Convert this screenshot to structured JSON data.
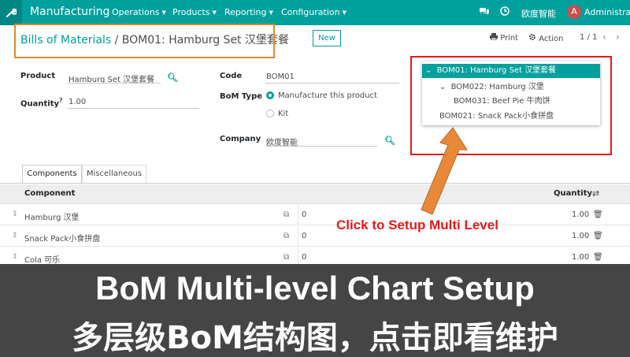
{
  "topbar": {
    "app_name": "Manufacturing",
    "menus": [
      "Operations",
      "Products",
      "Reporting",
      "Configuration"
    ],
    "company": "欧度智能",
    "avatar_letter": "A",
    "user": "Administrator",
    "accent_color": "#00a09d"
  },
  "control_panel": {
    "breadcrumb_parent": "Bills of Materials",
    "breadcrumb_sep": "/",
    "breadcrumb_current": "BOM01: Hamburg Set 汉堡套餐",
    "new_label": "New",
    "print_label": "Print",
    "action_label": "Action",
    "pager": "1 / 1"
  },
  "form": {
    "product_label": "Product",
    "product_value": "Hamburg Set 汉堡套餐",
    "quantity_label": "Quantity",
    "quantity_required": "?",
    "quantity_value": "1.00",
    "code_label": "Code",
    "code_value": "BOM01",
    "bom_type_label": "BoM Type",
    "bom_type_options": [
      "Manufacture this product",
      "Kit"
    ],
    "bom_type_selected": "Manufacture this product",
    "company_label": "Company",
    "company_value": "欧度智能"
  },
  "bom_tree": {
    "root": "BOM01: Hamburg Set 汉堡套餐",
    "children": [
      {
        "label": "BOM022: Hamburg 汉堡",
        "children": [
          "BOM031: Beef Pie 牛肉饼"
        ]
      },
      {
        "label": "BOM021: Snack Pack小食拼盘",
        "children": []
      }
    ]
  },
  "tabs": [
    "Components",
    "Miscellaneous"
  ],
  "table": {
    "headers": {
      "component": "Component",
      "quantity": "Quantity"
    },
    "rows": [
      {
        "component": "Hamburg 汉堡",
        "value": "0",
        "quantity": "1.00"
      },
      {
        "component": "Snack Pack小食拼盘",
        "value": "0",
        "quantity": "1.00"
      },
      {
        "component": "Cola 可乐",
        "value": "0",
        "quantity": "1.00"
      }
    ]
  },
  "annotation": {
    "text": "Click to Setup Multi Level",
    "color": "#e31b1b"
  },
  "banner": {
    "line_en": "BoM Multi-level Chart Setup",
    "line_zh": "多层级BoM结构图，点击即看维护"
  }
}
